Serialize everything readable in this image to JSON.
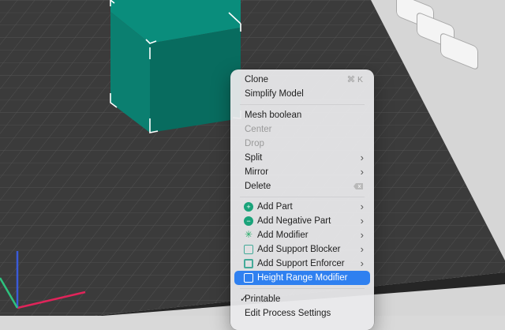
{
  "context_menu": {
    "clone": {
      "label": "Clone",
      "shortcut": "⌘ K"
    },
    "simplify_model": "Simplify Model",
    "mesh_boolean": "Mesh boolean",
    "center": "Center",
    "drop": "Drop",
    "split": "Split",
    "mirror": "Mirror",
    "delete": "Delete",
    "add_part": "Add Part",
    "add_negative_part": "Add Negative Part",
    "add_modifier": "Add Modifier",
    "add_support_blocker": "Add Support Blocker",
    "add_support_enforcer": "Add Support Enforcer",
    "height_range_modifier": "Height Range Modifier",
    "printable": {
      "label": "Printable",
      "check": "✓"
    },
    "edit_process_settings": "Edit Process Settings"
  },
  "icons": {
    "submenu": "chevron-right-icon",
    "delete": "backspace-icon",
    "add_part": "add-part-icon",
    "add_negative_part": "negative-part-icon",
    "add_modifier": "modifier-icon",
    "add_support_blocker": "support-blocker-icon",
    "add_support_enforcer": "support-enforcer-icon",
    "height_range_modifier": "height-range-icon"
  },
  "colors": {
    "cube_top": "#0a8d7c",
    "cube_side": "#086c5f",
    "plate": "#3b3b3b",
    "grid_line": "#555555",
    "highlight": "#2f80f0",
    "axis_x": "#e0245a",
    "axis_y": "#2ec27e",
    "axis_z": "#3a5bd9"
  }
}
